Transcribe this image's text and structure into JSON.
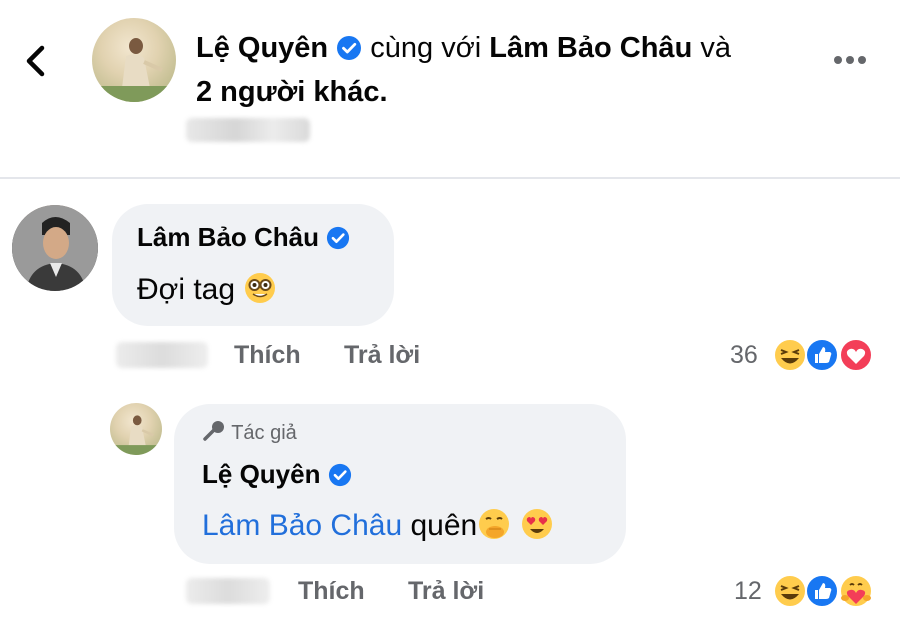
{
  "header": {
    "author_name": "Lệ Quyên",
    "tag_text": "cùng với",
    "tagged_name": "Lâm Bảo Châu",
    "and_text": "và",
    "others_text": "2 người khác."
  },
  "comment": {
    "author_name": "Lâm Bảo Châu",
    "text": "Đợi tag",
    "like_label": "Thích",
    "reply_label": "Trả lời",
    "reaction_count": "36"
  },
  "reply": {
    "author_badge": "Tác giả",
    "author_name": "Lệ Quyên",
    "mention": "Lâm Bảo Châu",
    "text": "quên",
    "like_label": "Thích",
    "reply_label": "Trả lời",
    "reaction_count": "12"
  },
  "icons": {
    "back": "chevron-left-icon",
    "more": "more-horizontal-icon",
    "verified": "verified-badge-icon",
    "author": "microphone-icon",
    "reactions_comment": [
      "haha-icon",
      "like-icon",
      "love-icon"
    ],
    "reactions_reply": [
      "haha-icon",
      "like-icon",
      "care-icon"
    ],
    "emoji_comment": [
      "nerd-face-emoji"
    ],
    "emoji_reply": [
      "face-hand-over-mouth-emoji",
      "heart-eyes-emoji"
    ]
  },
  "colors": {
    "link": "#216fdb",
    "verified": "#1877f2",
    "muted": "#65676b",
    "bubble": "#f0f2f5"
  }
}
